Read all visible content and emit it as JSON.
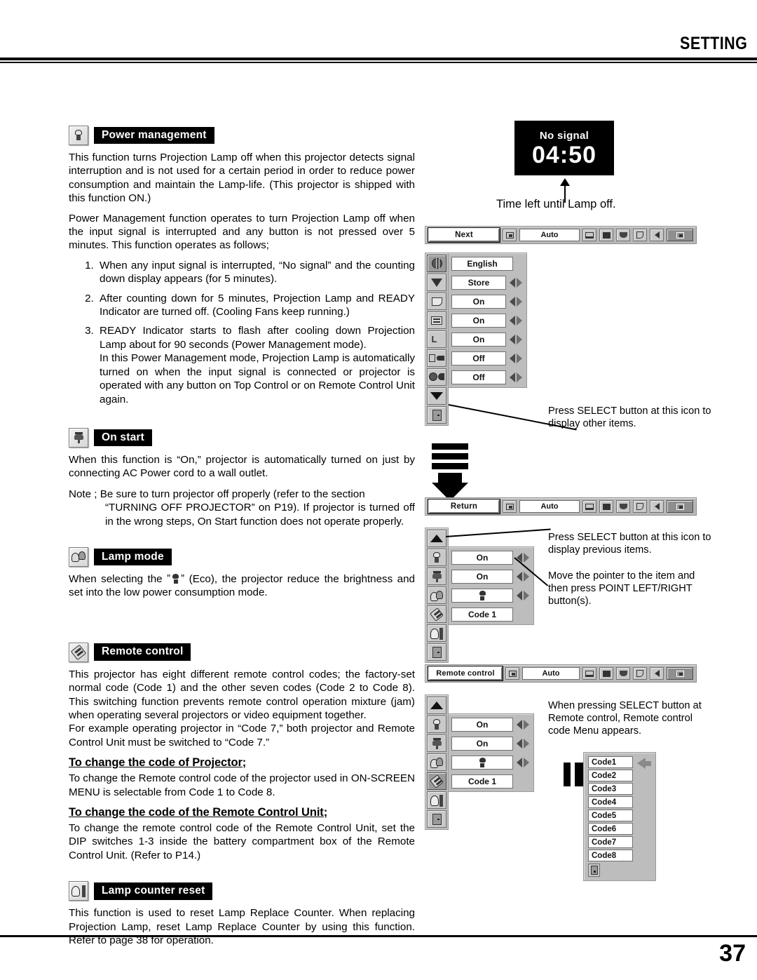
{
  "header": {
    "title": "SETTING"
  },
  "footer": {
    "page_number": "37"
  },
  "sections": [
    {
      "id": "power-management",
      "badge_label": "Power management",
      "icon": "lamp-icon",
      "paragraphs": [
        "This function turns Projection Lamp off when this projector detects signal interruption and is not used for a certain period in order to reduce power consumption and maintain the Lamp-life.  (This projector is shipped with this function ON.)",
        "Power Management function operates to turn Projection Lamp off when the input signal is interrupted and any button is not pressed over 5 minutes.  This function operates as follows;"
      ],
      "numbered": [
        "When any input signal is interrupted, “No signal” and the counting down display appears (for 5 minutes).",
        "After counting down for 5 minutes, Projection Lamp and READY Indicator are turned off.  (Cooling Fans keep running.)",
        "READY Indicator starts to flash after cooling down Projection Lamp about for 90 seconds (Power Management mode).",
        "In this Power Management mode, Projection Lamp is automatically turned on when the input signal is connected or projector is operated with any button on Top Control or on Remote Control Unit again."
      ]
    },
    {
      "id": "on-start",
      "badge_label": "On start",
      "icon": "power-plug-icon",
      "paragraphs": [
        "When this function is “On,” projector is automatically turned on just by connecting AC Power cord to a wall outlet."
      ],
      "note_lead": "Note ; Be sure to turn projector off properly (refer to the section",
      "note_rest": "“TURNING OFF PROJECTOR” on P19).  If projector is turned off in the wrong steps, On Start function does not operate properly."
    },
    {
      "id": "lamp-mode",
      "badge_label": "Lamp mode",
      "icon": "two-lamps-icon",
      "text_before": "When selecting the ˮ",
      "text_after": "ˮ (Eco), the projector reduce the brightness and set into the low power consumption mode."
    },
    {
      "id": "remote-control",
      "badge_label": "Remote control",
      "icon": "remote-control-icon",
      "paragraphs": [
        "This projector has eight different remote control codes; the factory-set normal code (Code 1) and the other seven codes (Code 2 to Code 8).  This switching function prevents remote control operation mixture (jam) when operating several projectors or video equipment together.",
        "For example operating projector in “Code 7,”  both projector and Remote Control Unit must be switched to “Code 7.”"
      ],
      "subhead_1": "To change the code of Projector;",
      "sub_text_1": "To change the Remote control code of the projector used in ON-SCREEN MENU is selectable from Code 1 to Code 8.",
      "subhead_2": "To change the code of the Remote Control Unit;",
      "sub_text_2": "To change the remote control code of the Remote Control Unit, set the DIP switches 1-3 inside the battery compartment box of the Remote Control Unit. (Refer to P14.)"
    },
    {
      "id": "lamp-counter-reset",
      "badge_label": "Lamp counter reset",
      "icon": "lamp-reset-icon",
      "paragraphs": [
        "This function is used to reset Lamp Replace Counter.  When replacing Projection Lamp, reset Lamp Replace Counter by using this function.  Refer to page 38 for operation."
      ]
    }
  ],
  "osd": {
    "no_signal": {
      "label": "No signal",
      "time": "04:50"
    },
    "time_left_caption": "Time left until Lamp off.",
    "menubar_1": {
      "main": "Next",
      "auto": "Auto"
    },
    "menubar_2": {
      "main": "Return",
      "auto": "Auto"
    },
    "menubar_3": {
      "main": "Remote control",
      "auto": "Auto"
    },
    "panel_1_rows": [
      {
        "icon": "language-globe-icon",
        "value": "English",
        "has_arrows": false,
        "selected": true
      },
      {
        "icon": "keystone-icon",
        "value": "Store",
        "has_arrows": true,
        "selected": false
      },
      {
        "icon": "blue-back-icon",
        "value": "On",
        "has_arrows": true,
        "selected": false
      },
      {
        "icon": "display-icon",
        "value": "On",
        "has_arrows": true,
        "selected": false
      },
      {
        "icon": "logo-icon",
        "value": "On",
        "has_arrows": true,
        "selected": false
      },
      {
        "icon": "ceiling-icon",
        "value": "Off",
        "has_arrows": true,
        "selected": false
      },
      {
        "icon": "rear-icon",
        "value": "Off",
        "has_arrows": true,
        "selected": false
      }
    ],
    "panel_1_extra_icons": [
      "scroll-down-icon",
      "exit-door-icon"
    ],
    "panel_2_rows": [
      {
        "icon": "power-management-lamp-icon",
        "value": "On",
        "has_arrows": true
      },
      {
        "icon": "on-start-plug-icon",
        "value": "On",
        "has_arrows": true
      },
      {
        "icon": "lamp-mode-icon",
        "value": "",
        "has_arrows": true,
        "value_is_eco_glyph": true
      },
      {
        "icon": "remote-control-icon",
        "value": "Code 1",
        "has_arrows": false
      }
    ],
    "panel_2_top_icon": "scroll-up-icon",
    "panel_2_extra_icons": [
      "lamp-counter-reset-icon",
      "exit-door-icon"
    ],
    "code_menu": {
      "items": [
        "Code1",
        "Code2",
        "Code3",
        "Code4",
        "Code5",
        "Code6",
        "Code7",
        "Code8"
      ],
      "exit_icon": "exit-door-icon"
    },
    "callouts": [
      "Press SELECT button at this icon to display other items.",
      "Press SELECT button at this icon to display previous items.",
      "Move the pointer to the item and then press POINT LEFT/RIGHT button(s).",
      "When pressing SELECT button at Remote control, Remote control code Menu appears."
    ]
  }
}
